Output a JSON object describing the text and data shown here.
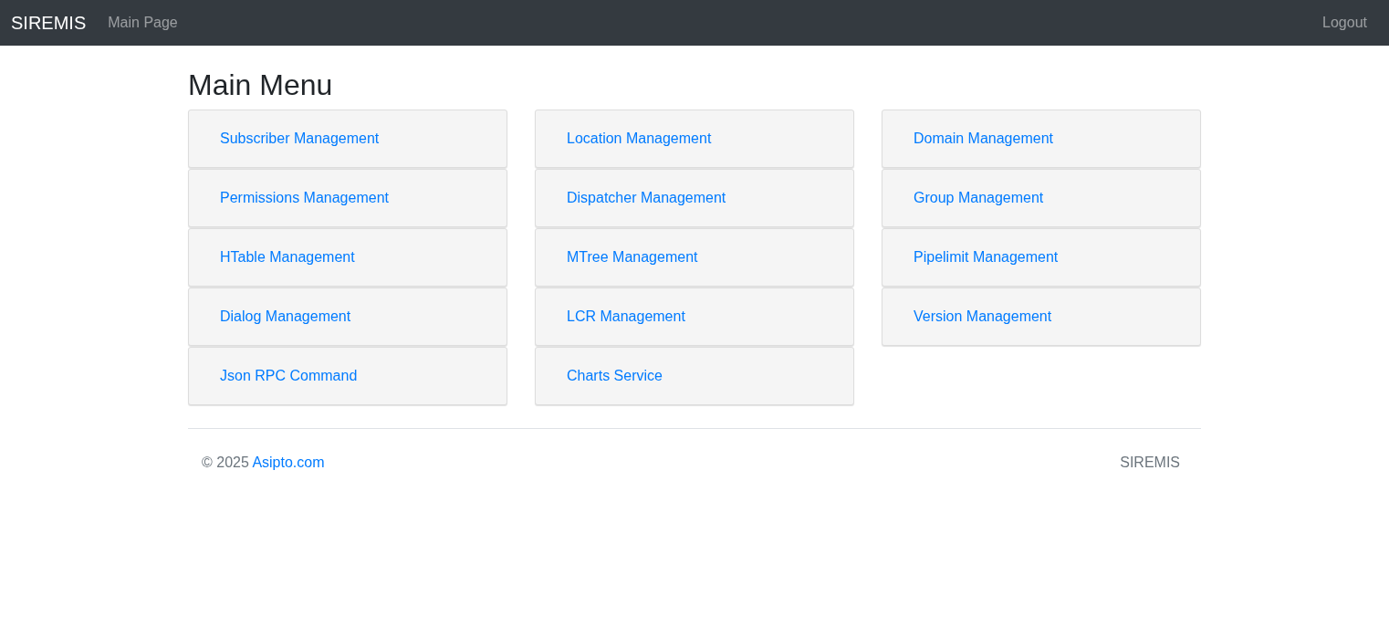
{
  "navbar": {
    "brand": "SIREMIS",
    "links": [
      {
        "label": "Main Page"
      }
    ],
    "right_link": "Logout"
  },
  "title": "Main Menu",
  "menu_columns": [
    {
      "items": [
        "Subscriber Management",
        "Permissions Management",
        "HTable Management",
        "Dialog Management",
        "Json RPC Command"
      ]
    },
    {
      "items": [
        "Location Management",
        "Dispatcher Management",
        "MTree Management",
        "LCR Management",
        "Charts Service"
      ]
    },
    {
      "items": [
        "Domain Management",
        "Group Management",
        "Pipelimit Management",
        "Version Management"
      ]
    }
  ],
  "footer": {
    "copyright": "© 2025",
    "link": "Asipto.com",
    "right": "SIREMIS"
  }
}
